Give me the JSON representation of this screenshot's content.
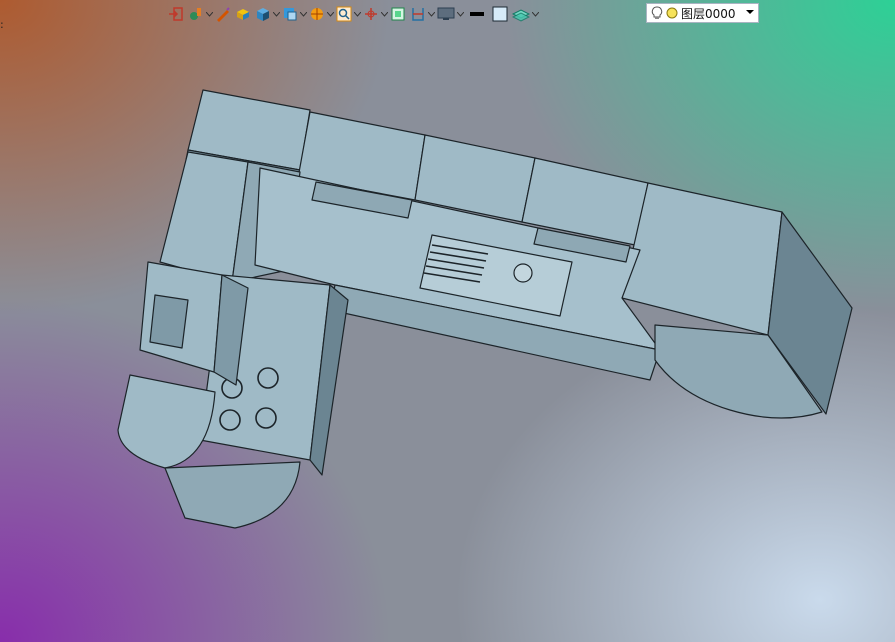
{
  "layer": {
    "name": "图层0000"
  },
  "edge_mark": ":",
  "colors": {
    "cabinet_top": "#9fbac6",
    "cabinet_side": "#7f9aa7",
    "cabinet_dark": "#6b8592",
    "edge": "#1c2429",
    "layer_bulb": "#f6e25a"
  },
  "toolbar_icons": [
    "exit-icon",
    "paint-icon",
    "pen-icon",
    "box-icon",
    "cube-icon",
    "view-icon",
    "sphere-icon",
    "zoom-icon",
    "axis-icon",
    "frame-icon",
    "section-icon",
    "monitor-icon",
    "line-weight-icon",
    "color-square-icon",
    "layers-icon"
  ]
}
